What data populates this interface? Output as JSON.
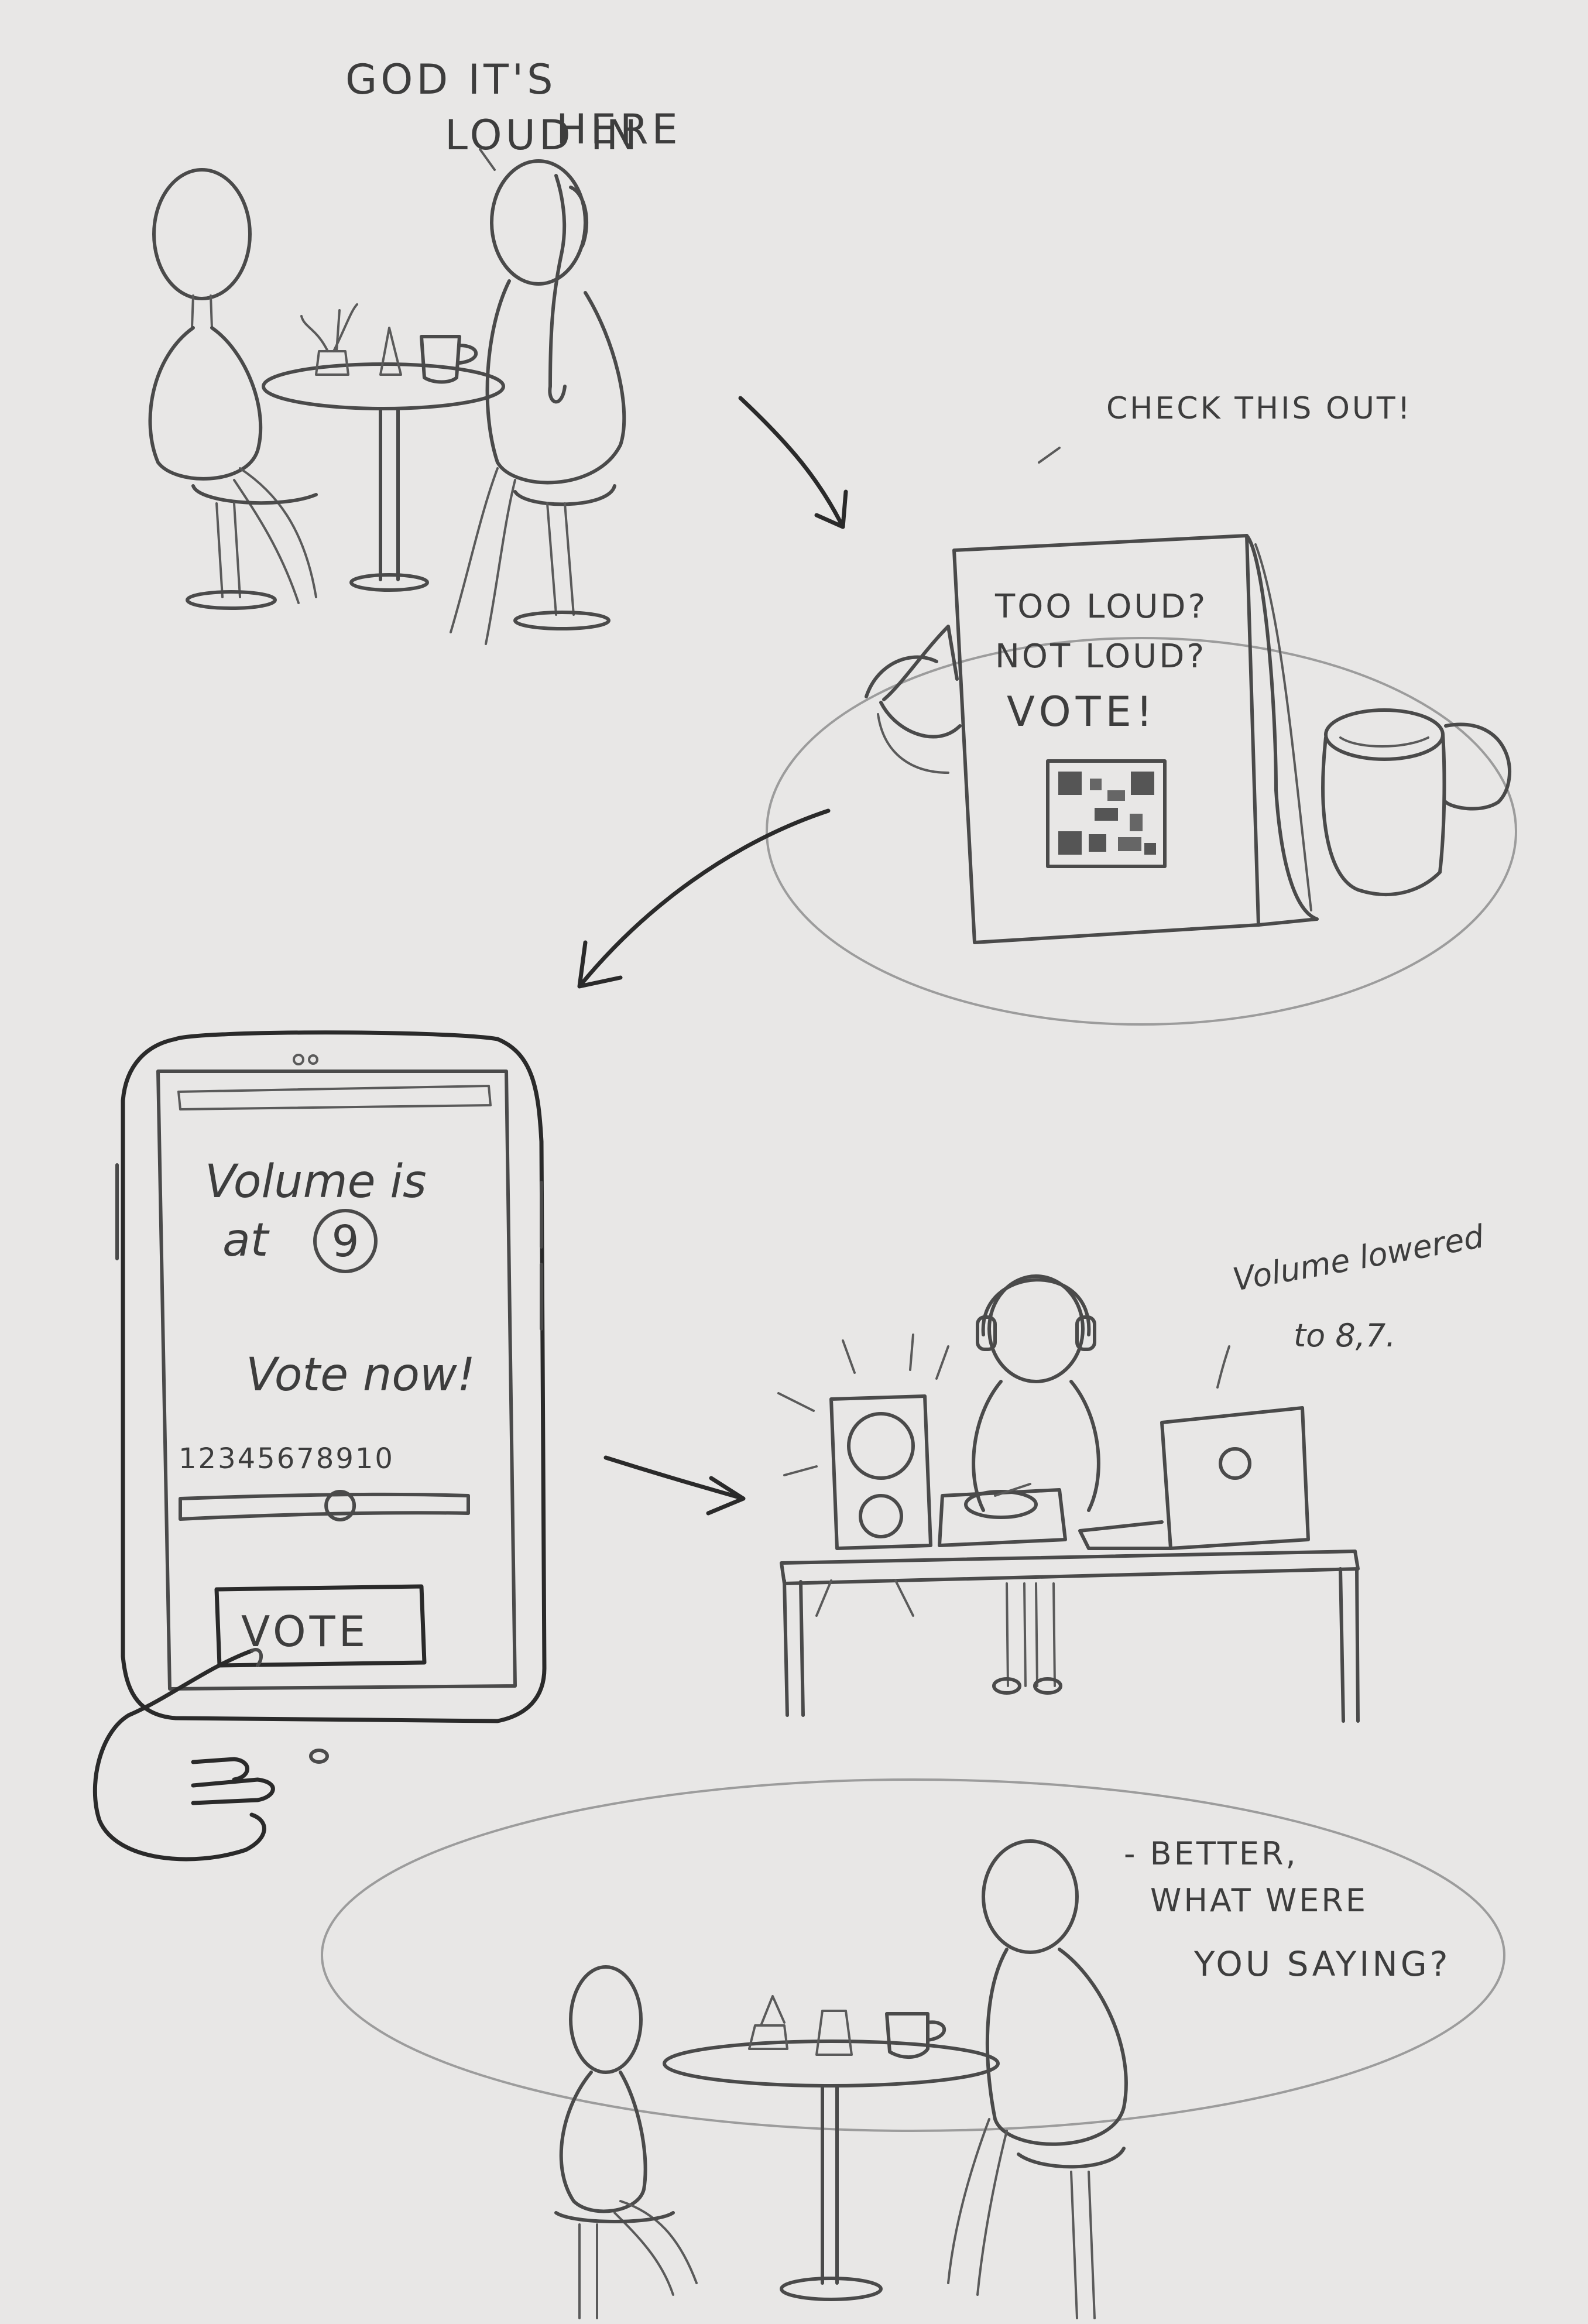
{
  "scene1": {
    "speech": [
      "GOD IT'S",
      "LOUD IN",
      "HERE"
    ]
  },
  "scene2": {
    "speech": "CHECK THIS OUT!",
    "sign": {
      "line1": "TOO LOUD?",
      "line2": "NOT LOUD?",
      "line3": "VOTE!"
    }
  },
  "phone": {
    "volume_line1": "Volume is",
    "volume_line2": "at",
    "volume_value": "9",
    "vote_now": "Vote now!",
    "scale_labels": "12345678910",
    "slider_value": 6,
    "vote_button": "VOTE"
  },
  "scene4": {
    "note_line1": "Volume lowered",
    "note_line2": "to 8,7."
  },
  "scene5": {
    "speech": [
      "- BETTER,",
      "WHAT WERE",
      "YOU SAYING?"
    ]
  }
}
